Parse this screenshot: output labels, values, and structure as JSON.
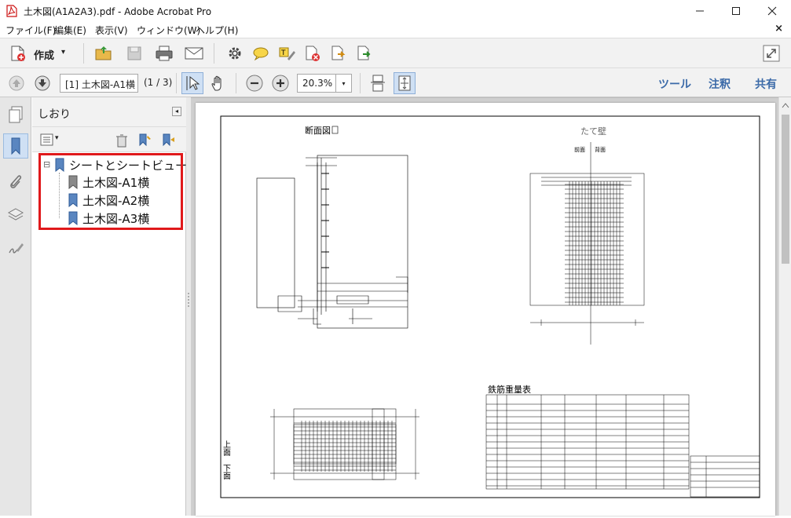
{
  "window": {
    "title": "土木図(A1A2A3).pdf - Adobe Acrobat Pro",
    "minimize": "—",
    "maximize": "☐",
    "close": "✕"
  },
  "menu": [
    "ファイル(F)",
    "編集(E)",
    "表示(V)",
    "ウィンドウ(W)",
    "ヘルプ(H)"
  ],
  "menu_close": "×",
  "toolbar": {
    "create_label": "作成",
    "create_caret": "▾"
  },
  "nav": {
    "page_value": "[1] 土木図-A1横",
    "page_count": "(1 / 3)",
    "zoom_value": "20.3%",
    "zoom_caret": "▾",
    "tools": "ツール",
    "comment": "注釈",
    "share": "共有"
  },
  "bookmarks": {
    "panel_title": "しおり",
    "collapse": "◂",
    "options_caret": "▾",
    "items": [
      {
        "label": "シートとシートビュー",
        "expander": "⊟"
      },
      {
        "label": "土木図-A1横"
      },
      {
        "label": "土木図-A2横"
      },
      {
        "label": "土木図-A3横"
      }
    ]
  },
  "drawing": {
    "section_label": "断面図",
    "wall_label": "たて壁",
    "front_label": "前面",
    "back_label": "背面",
    "table_title": "鉄筋重量表",
    "plan_upper": "上面",
    "plan_lower": "下面"
  },
  "colors": {
    "accent_blue": "#3b6aa8",
    "highlight_red": "#e0191b",
    "panel_bg": "#f2f2f2",
    "doc_bg": "#cfcfcf"
  }
}
